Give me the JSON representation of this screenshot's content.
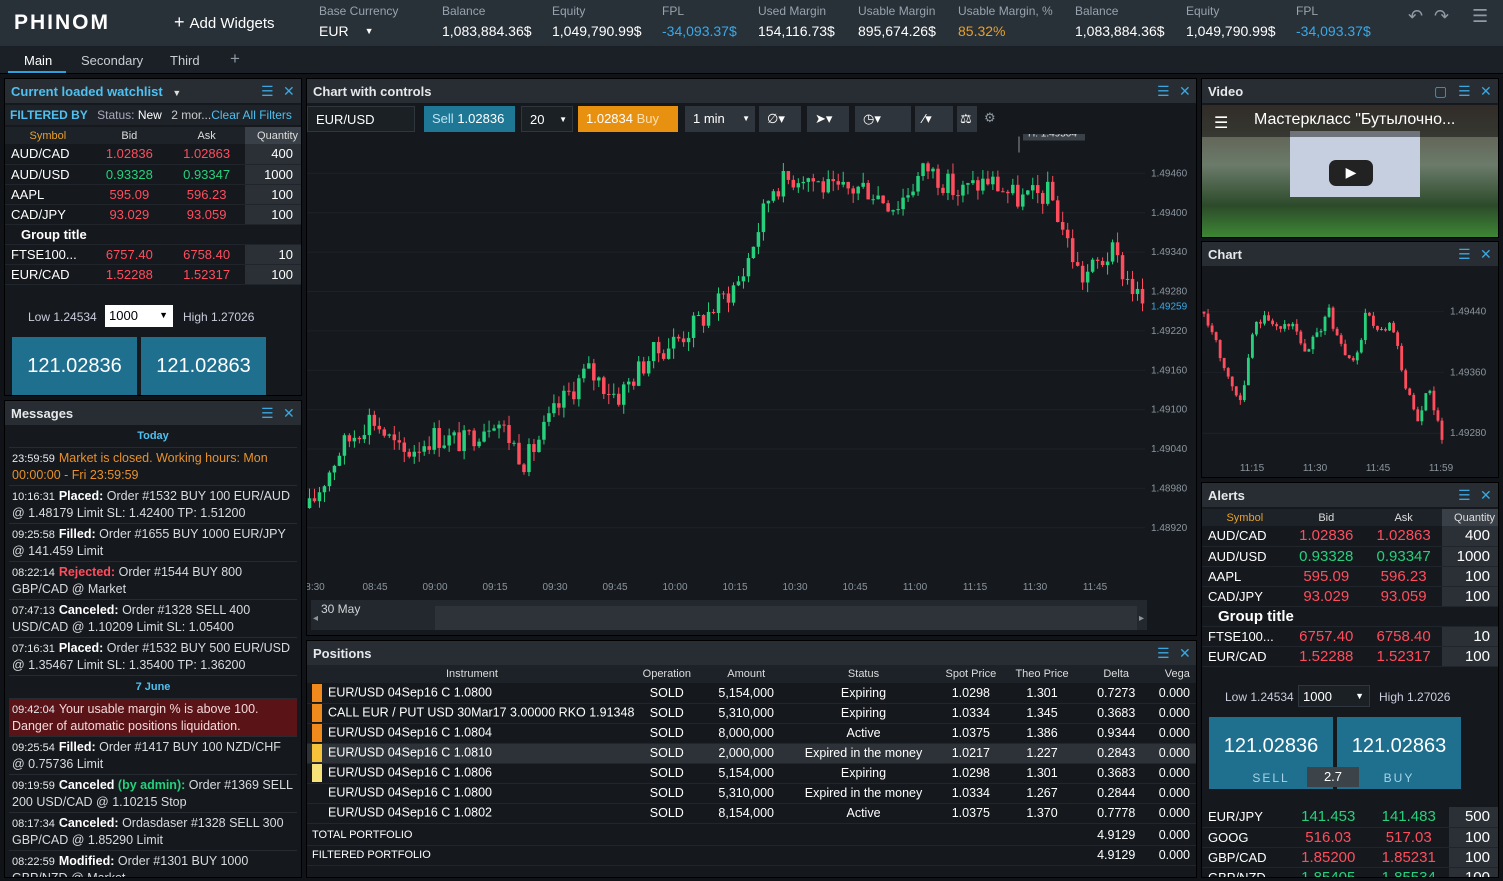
{
  "brand": "PHINOM",
  "add_widgets": "Add Widgets",
  "header": {
    "base_currency_label": "Base Currency",
    "base_currency_value": "EUR",
    "stats": [
      {
        "label": "Balance",
        "value": "1,083,884.36$"
      },
      {
        "label": "Equity",
        "value": "1,049,790.99$"
      },
      {
        "label": "FPL",
        "value": "-34,093.37$"
      },
      {
        "label": "Used Margin",
        "value": "154,116.73$"
      },
      {
        "label": "Usable Margin",
        "value": "895,674.26$"
      },
      {
        "label": "Usable Margin, %",
        "value": "85.32%"
      },
      {
        "label": "Balance",
        "value": "1,083,884.36$"
      },
      {
        "label": "Equity",
        "value": "1,049,790.99$"
      },
      {
        "label": "FPL",
        "value": "-34,093.37$"
      }
    ]
  },
  "tabs": [
    {
      "label": "Main"
    },
    {
      "label": "Secondary"
    },
    {
      "label": "Third"
    },
    {
      "label": "+"
    }
  ],
  "watchlist": {
    "title": "Current loaded watchlist",
    "filter_label": "FILTERED BY",
    "filter_status": "Status:",
    "filter_value": "New",
    "filter_more": "2 mor...",
    "clear_filters": "Clear All Filters",
    "columns": [
      "Symbol",
      "Bid",
      "Ask",
      "Quantity"
    ],
    "rows": [
      {
        "symbol": "AUD/CAD",
        "bid": "1.02836",
        "ask": "1.02863",
        "qty": "400",
        "dir": "r"
      },
      {
        "symbol": "AUD/USD",
        "bid": "0.93328",
        "ask": "0.93347",
        "qty": "1000",
        "dir": "g"
      },
      {
        "symbol": "AAPL",
        "bid": "595.09",
        "ask": "596.23",
        "qty": "100",
        "dir": "r"
      },
      {
        "symbol": "CAD/JPY",
        "bid": "93.029",
        "ask": "93.059",
        "qty": "100",
        "dir": "r"
      },
      {
        "group": "Group title"
      },
      {
        "symbol": "FTSE100...",
        "bid": "6757.40",
        "ask": "6758.40",
        "qty": "10",
        "dir": "r"
      },
      {
        "symbol": "EUR/CAD",
        "bid": "1.52288",
        "ask": "1.52317",
        "qty": "100",
        "dir": "r"
      }
    ],
    "ticket": {
      "low": "Low 1.24534",
      "amount": "1000",
      "high": "High 1.27026",
      "sell": "121.02836",
      "buy": "121.02863",
      "spread": "2.7",
      "sell_label": "SELL",
      "buy_label": "BUY"
    }
  },
  "messages": {
    "title": "Messages",
    "items": [
      {
        "type": "day",
        "text": "Today"
      },
      {
        "type": "or",
        "time": "23:59:59",
        "text": "Market is closed. Working hours: Mon 00:00:00 - Fri 23:59:59"
      },
      {
        "time": "10:16:31",
        "kind": "Placed:",
        "text": "Order #1532 BUY 100 EUR/AUD @ 1.48179 Limit SL: 1.42400 TP: 1.51200"
      },
      {
        "time": "09:25:58",
        "kind": "Filled:",
        "text": "Order #1655 BUY 1000 EUR/JPY @ 141.459 Limit"
      },
      {
        "time": "08:22:14",
        "kind": "Rejected:",
        "kcls": "rk",
        "text": "Order #1544 BUY 800 GBP/CAD @ Market"
      },
      {
        "time": "07:47:13",
        "kind": "Canceled:",
        "text": "Order #1328 SELL 400 USD/CAD @ 1.10209 Limit SL: 1.05400"
      },
      {
        "time": "07:16:31",
        "kind": "Placed:",
        "text": "Order #1532 BUY 500 EUR/USD @ 1.35467 Limit SL: 1.35400 TP: 1.36200"
      },
      {
        "type": "day",
        "text": "7 June"
      },
      {
        "type": "alert",
        "time": "09:42:04",
        "text": "Your usable margin % is above 100. Danger of automatic positions liquidation."
      },
      {
        "time": "09:25:54",
        "kind": "Filled:",
        "text": "Order #1417 BUY 100 NZD/CHF @ 0.75736 Limit"
      },
      {
        "time": "09:19:59",
        "kind": "Canceled",
        "extra": "(by admin):",
        "text": "Order #1369 SELL 200 USD/CAD @ 1.10215 Stop"
      },
      {
        "time": "08:17:34",
        "kind": "Canceled:",
        "text": "Ordasdaser #1328 SELL 300 GBP/CAD @ 1.85290 Limit"
      },
      {
        "time": "08:22:59",
        "kind": "Modified:",
        "text": "Order #1301 BUY 1000 GBP/NZD @ Market"
      }
    ]
  },
  "chart_controls": {
    "title": "Chart with controls",
    "symbol": "EUR/USD",
    "sell_label": "Sell",
    "sell_price": "1.02836",
    "amount": "20",
    "buy_price": "1.02834",
    "buy_label": "Buy",
    "interval": "1 min",
    "high_tag": "H: 1.49504",
    "last_tag": "1.49259",
    "date_label": "30 May"
  },
  "chart_data": [
    {
      "type": "candlestick",
      "title": "Chart with controls",
      "symbol": "EUR/USD",
      "x_ticks": [
        "8:30",
        "08:45",
        "09:00",
        "09:15",
        "09:30",
        "09:45",
        "10:00",
        "10:15",
        "10:30",
        "10:45",
        "11:00",
        "11:15",
        "11:30",
        "11:45"
      ],
      "y_ticks": [
        "1.49460",
        "1.49400",
        "1.49340",
        "1.49280",
        "1.49220",
        "1.49160",
        "1.49100",
        "1.49040",
        "1.48980",
        "1.48920"
      ],
      "ylim": [
        1.4888,
        1.4952
      ],
      "high": 1.49504,
      "last": 1.49259,
      "trend": [
        1.4895,
        1.4904,
        1.4909,
        1.4903,
        1.4906,
        1.4905,
        1.4909,
        1.4902,
        1.491,
        1.4916,
        1.4912,
        1.4918,
        1.4921,
        1.4925,
        1.493,
        1.4944,
        1.4946,
        1.4943,
        1.4944,
        1.4941,
        1.4947,
        1.4943,
        1.4945,
        1.4942,
        1.4943,
        1.493,
        1.4934,
        1.4926
      ]
    },
    {
      "type": "candlestick",
      "title": "Chart",
      "x_ticks": [
        "11:15",
        "11:30",
        "11:45",
        "11:59"
      ],
      "y_ticks": [
        "1.49440",
        "1.49360",
        "1.49280"
      ],
      "ylim": [
        1.4925,
        1.495
      ],
      "trend": [
        1.4944,
        1.494,
        1.4935,
        1.4932,
        1.4942,
        1.4944,
        1.4941,
        1.4943,
        1.4938,
        1.4941,
        1.4944,
        1.4939,
        1.4937,
        1.4944,
        1.4941,
        1.4942,
        1.4935,
        1.4929,
        1.4934,
        1.4927
      ]
    }
  ],
  "video": {
    "title": "Video",
    "caption": "Мастеркласс \"Бутылочно..."
  },
  "chart_small": {
    "title": "Chart"
  },
  "alerts": {
    "title": "Alerts",
    "columns": [
      "Symbol",
      "Bid",
      "Ask",
      "Quantity"
    ],
    "rows": [
      {
        "symbol": "AUD/CAD",
        "bid": "1.02836",
        "ask": "1.02863",
        "qty": "400",
        "dir": "r"
      },
      {
        "symbol": "AUD/USD",
        "bid": "0.93328",
        "ask": "0.93347",
        "qty": "1000",
        "dir": "g"
      },
      {
        "symbol": "AAPL",
        "bid": "595.09",
        "ask": "596.23",
        "qty": "100",
        "dir": "r"
      },
      {
        "symbol": "CAD/JPY",
        "bid": "93.029",
        "ask": "93.059",
        "qty": "100",
        "dir": "r"
      },
      {
        "group": "Group title"
      },
      {
        "symbol": "FTSE100...",
        "bid": "6757.40",
        "ask": "6758.40",
        "qty": "10",
        "dir": "r"
      },
      {
        "symbol": "EUR/CAD",
        "bid": "1.52288",
        "ask": "1.52317",
        "qty": "100",
        "dir": "r"
      }
    ],
    "ticket": {
      "low": "Low 1.24534",
      "amount": "1000",
      "high": "High 1.27026",
      "sell": "121.02836",
      "buy": "121.02863",
      "spread": "2.7",
      "sell_label": "SELL",
      "buy_label": "BUY"
    },
    "rows2": [
      {
        "symbol": "EUR/JPY",
        "bid": "141.453",
        "ask": "141.483",
        "qty": "500",
        "dir": "g"
      },
      {
        "symbol": "GOOG",
        "bid": "516.03",
        "ask": "517.03",
        "qty": "100",
        "dir": "r"
      },
      {
        "symbol": "GBP/CAD",
        "bid": "1.85200",
        "ask": "1.85231",
        "qty": "100",
        "dir": "r"
      },
      {
        "symbol": "GBP/NZD",
        "bid": "1.85405",
        "ask": "1.85534",
        "qty": "100",
        "dir": "g"
      }
    ]
  },
  "positions": {
    "title": "Positions",
    "columns": [
      "Instrument",
      "Operation",
      "Amount",
      "Status",
      "Spot Price",
      "Theo Price",
      "Delta",
      "Vega"
    ],
    "rows": [
      {
        "mark": "#f08a1c",
        "instrument": "EUR/USD 04Sep16 C 1.0800",
        "op": "SOLD",
        "amount": "5,154,000",
        "status": "Expiring",
        "spot": "1.0298",
        "theo": "1.301",
        "delta": "0.7273",
        "vega": "0.000"
      },
      {
        "mark": "#f08a1c",
        "instrument": "CALL EUR / PUT USD 30Mar17 3.00000 RKO 1.91348",
        "op": "SOLD",
        "amount": "5,310,000",
        "status": "Expiring",
        "spot": "1.0334",
        "theo": "1.345",
        "delta": "0.3683",
        "vega": "0.000"
      },
      {
        "mark": "#f08a1c",
        "instrument": "EUR/USD 04Sep16 C 1.0804",
        "op": "SOLD",
        "amount": "8,000,000",
        "status": "Active",
        "spot": "1.0375",
        "theo": "1.386",
        "delta": "0.9344",
        "vega": "0.000"
      },
      {
        "mark": "#f5c23a",
        "instrument": "EUR/USD 04Sep16 C 1.0810",
        "op": "SOLD",
        "amount": "2,000,000",
        "status": "Expired in the money",
        "spot": "1.0217",
        "theo": "1.227",
        "delta": "0.2843",
        "vega": "0.000",
        "hi": true
      },
      {
        "mark": "#f7e27a",
        "instrument": "EUR/USD 04Sep16 C 1.0806",
        "op": "SOLD",
        "amount": "5,154,000",
        "status": "Expiring",
        "spot": "1.0298",
        "theo": "1.301",
        "delta": "0.3683",
        "vega": "0.000"
      },
      {
        "mark": "",
        "instrument": "EUR/USD 04Sep16 C 1.0800",
        "op": "SOLD",
        "amount": "5,310,000",
        "status": "Expired in the money",
        "spot": "1.0334",
        "theo": "1.267",
        "delta": "0.2844",
        "vega": "0.000"
      },
      {
        "mark": "",
        "instrument": "EUR/USD 04Sep16 C 1.0802",
        "op": "SOLD",
        "amount": "8,154,000",
        "status": "Active",
        "spot": "1.0375",
        "theo": "1.370",
        "delta": "0.7778",
        "vega": "0.000"
      }
    ],
    "totals": [
      {
        "label": "TOTAL PORTFOLIO",
        "delta": "4.9129",
        "vega": "0.000"
      },
      {
        "label": "FILTERED PORTFOLIO",
        "delta": "4.9129",
        "vega": "0.000"
      }
    ]
  },
  "colors": {
    "accent": "#27a4dd",
    "up": "#26d07c",
    "down": "#ff4d5e",
    "buy": "#e8900f",
    "sell_btn": "#1f6f8e",
    "warning": "#e8a02c"
  }
}
